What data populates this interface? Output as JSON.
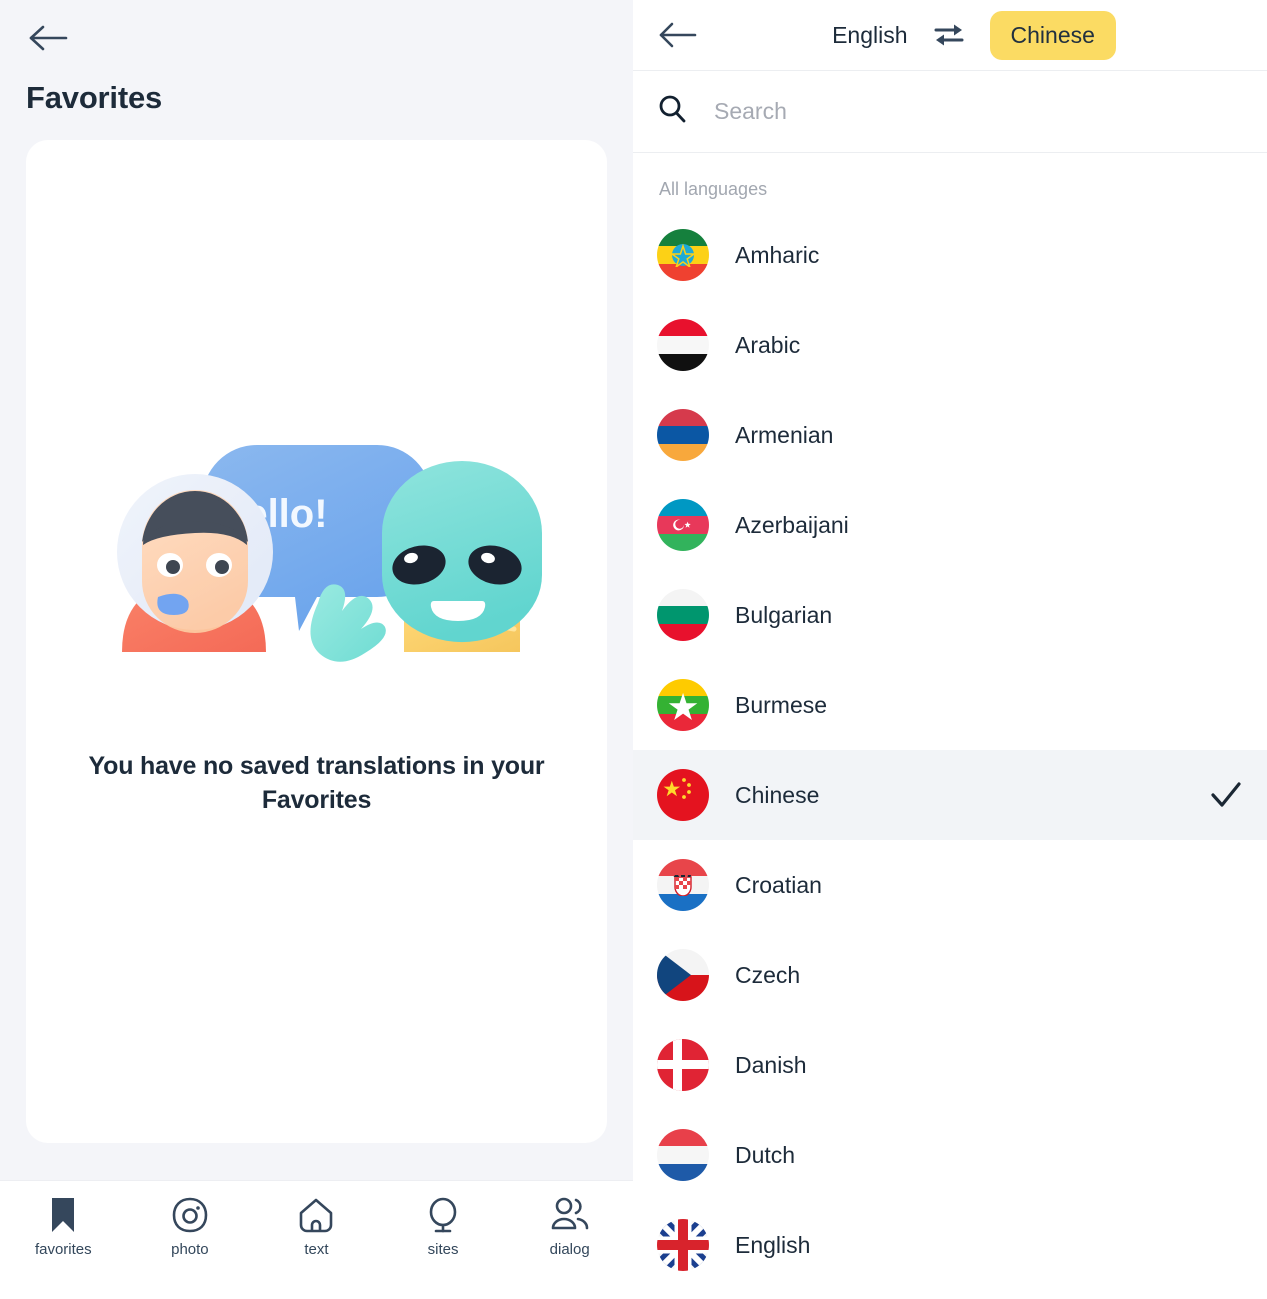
{
  "left": {
    "back_icon": "arrow-left-icon",
    "title": "Favorites",
    "illustration": {
      "name": "astronaut-alien-greeting-illustration",
      "speech_bubble_text": "Hello!"
    },
    "empty_state_text": "You have no saved translations in your Favorites",
    "bottom_nav": [
      {
        "label": "favorites",
        "icon": "bookmark-icon",
        "active": true
      },
      {
        "label": "photo",
        "icon": "camera-icon",
        "active": false
      },
      {
        "label": "text",
        "icon": "house-text-icon",
        "active": false
      },
      {
        "label": "sites",
        "icon": "globe-icon",
        "active": false
      },
      {
        "label": "dialog",
        "icon": "people-icon",
        "active": false
      }
    ]
  },
  "right": {
    "back_icon": "arrow-left-icon",
    "source_language": "English",
    "swap_icon": "swap-arrows-icon",
    "target_language": "Chinese",
    "target_pill_color": "#fbdb63",
    "search": {
      "icon": "search-icon",
      "placeholder": "Search",
      "value": ""
    },
    "section_label": "All languages",
    "selected_language": "Chinese",
    "check_icon": "check-icon",
    "languages": [
      {
        "name": "Amharic",
        "flag": "ethiopia",
        "selected": false
      },
      {
        "name": "Arabic",
        "flag": "yemen",
        "selected": false
      },
      {
        "name": "Armenian",
        "flag": "armenia",
        "selected": false
      },
      {
        "name": "Azerbaijani",
        "flag": "azerbaijan",
        "selected": false
      },
      {
        "name": "Bulgarian",
        "flag": "bulgaria",
        "selected": false
      },
      {
        "name": "Burmese",
        "flag": "myanmar",
        "selected": false
      },
      {
        "name": "Chinese",
        "flag": "china",
        "selected": true
      },
      {
        "name": "Croatian",
        "flag": "croatia",
        "selected": false
      },
      {
        "name": "Czech",
        "flag": "czech",
        "selected": false
      },
      {
        "name": "Danish",
        "flag": "denmark",
        "selected": false
      },
      {
        "name": "Dutch",
        "flag": "netherlands",
        "selected": false
      },
      {
        "name": "English",
        "flag": "uk",
        "selected": false
      }
    ]
  },
  "colors": {
    "page_background": "#f4f5f9",
    "card_background": "#ffffff",
    "text_primary": "#1d2b3a",
    "text_muted": "#a2a7b0",
    "accent_yellow": "#fbdb63",
    "selected_row": "#f2f4f7"
  }
}
